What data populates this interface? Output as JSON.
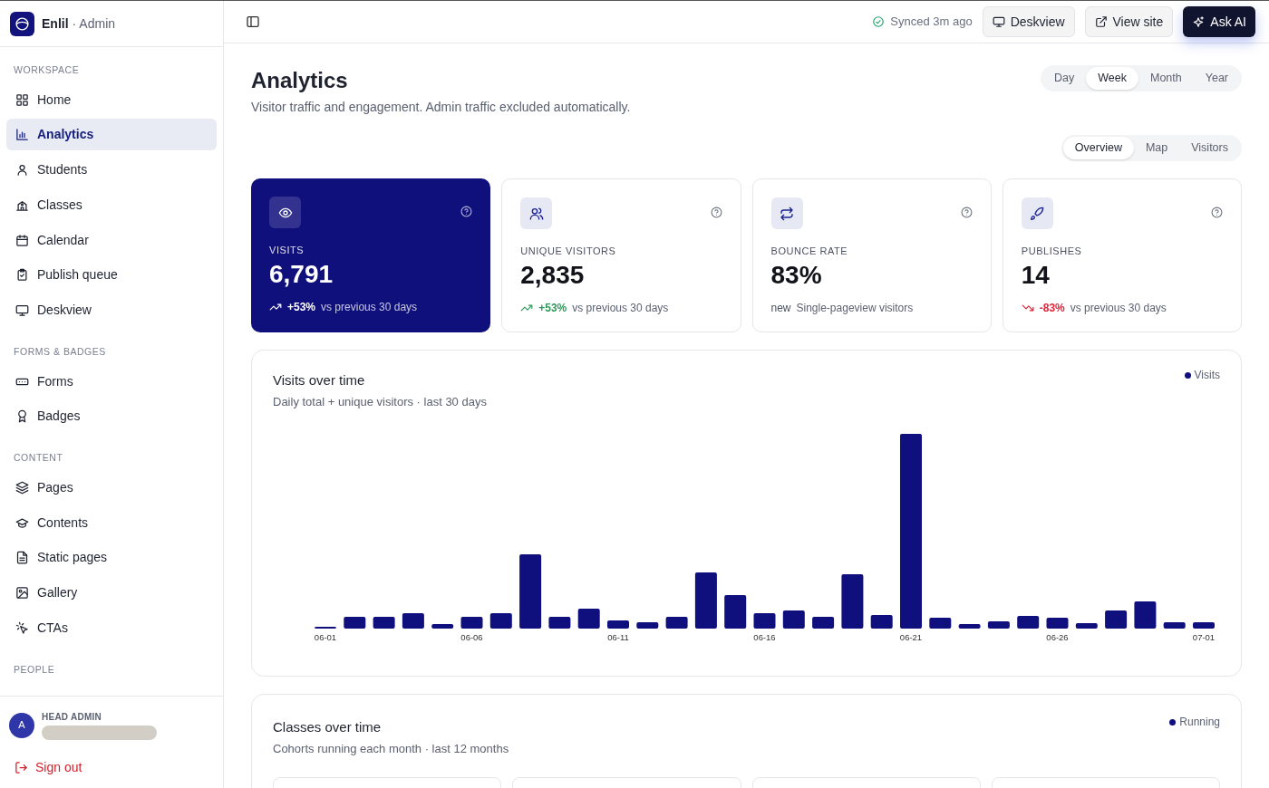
{
  "brand": {
    "name": "Enlil",
    "suffix": "· Admin"
  },
  "sidebar": {
    "sections": [
      {
        "title": "WORKSPACE",
        "items": [
          {
            "label": "Home",
            "selected": false
          },
          {
            "label": "Analytics",
            "selected": true
          },
          {
            "label": "Students",
            "selected": false
          },
          {
            "label": "Classes",
            "selected": false
          },
          {
            "label": "Calendar",
            "selected": false
          },
          {
            "label": "Publish queue",
            "selected": false
          },
          {
            "label": "Deskview",
            "selected": false
          }
        ]
      },
      {
        "title": "FORMS & BADGES",
        "items": [
          {
            "label": "Forms",
            "selected": false
          },
          {
            "label": "Badges",
            "selected": false
          }
        ]
      },
      {
        "title": "CONTENT",
        "items": [
          {
            "label": "Pages",
            "selected": false
          },
          {
            "label": "Contents",
            "selected": false
          },
          {
            "label": "Static pages",
            "selected": false
          },
          {
            "label": "Gallery",
            "selected": false
          },
          {
            "label": "CTAs",
            "selected": false
          }
        ]
      },
      {
        "title": "PEOPLE"
      }
    ]
  },
  "user": {
    "avatar": "A",
    "role": "HEAD ADMIN"
  },
  "sign_out": "Sign out",
  "topbar": {
    "sync": "Synced 3m ago",
    "buttons": [
      {
        "label": "Deskview",
        "kind": "monitor"
      },
      {
        "label": "View site",
        "kind": "external"
      },
      {
        "label": "Ask AI",
        "kind": "ai"
      }
    ]
  },
  "page": {
    "title": "Analytics",
    "subtitle": "Visitor traffic and engagement. Admin traffic excluded automatically."
  },
  "period_tabs": [
    {
      "label": "Day",
      "selected": false
    },
    {
      "label": "Week",
      "selected": true
    },
    {
      "label": "Month",
      "selected": false
    },
    {
      "label": "Year",
      "selected": false
    }
  ],
  "view_tabs": [
    {
      "label": "Overview",
      "selected": true
    },
    {
      "label": "Map",
      "selected": false
    },
    {
      "label": "Visitors",
      "selected": false
    }
  ],
  "stats": [
    {
      "label": "VISITS",
      "value": "6,791",
      "selected": true,
      "kind": "up",
      "change": "+53%",
      "note": "vs previous 30 days"
    },
    {
      "label": "UNIQUE VISITORS",
      "value": "2,835",
      "selected": false,
      "kind": "up",
      "change": "+53%",
      "note": "vs previous 30 days"
    },
    {
      "label": "BOUNCE RATE",
      "value": "83%",
      "selected": false,
      "kind": "flat",
      "change": "new",
      "note": "Single-pageview visitors"
    },
    {
      "label": "PUBLISHES",
      "value": "14",
      "selected": false,
      "kind": "down",
      "change": "-83%",
      "note": "vs previous 30 days"
    }
  ],
  "visits_chart": {
    "title": "Visits over time",
    "subtitle": "Daily total + unique visitors · last 30 days",
    "legend": {
      "label": "Visits",
      "color": "#0f0f7d"
    },
    "x_labels": [
      "06-01",
      "06-06",
      "06-11",
      "06-16",
      "06-21",
      "06-26",
      "07-01"
    ]
  },
  "classes_chart": {
    "title": "Classes over time",
    "subtitle": "Cohorts running each month · last 12 months",
    "legend": {
      "label": "Running",
      "color": "#0f0f7d"
    }
  }
}
